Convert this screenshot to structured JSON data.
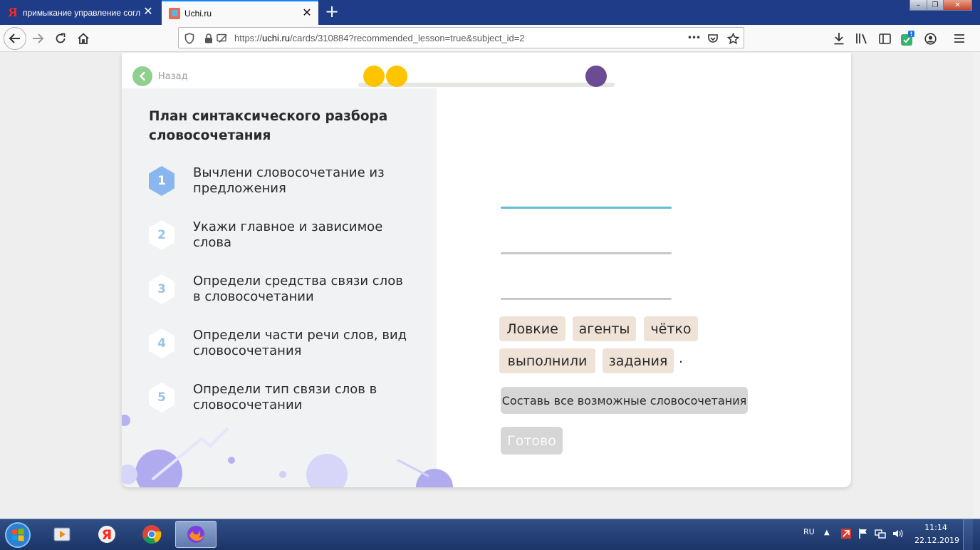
{
  "browser": {
    "tabs": [
      {
        "title": "примыкание управление соглас",
        "favicon": "yandex-icon",
        "active": false
      },
      {
        "title": "Uchi.ru",
        "favicon": "uchi-icon",
        "active": true
      }
    ],
    "url_prefix": "https://",
    "url_domain": "uchi.ru",
    "url_rest": "/cards/310884?recommended_lesson=true&subject_id=2",
    "url_more": "•••"
  },
  "lesson": {
    "back_label": "Назад",
    "progress_dots": [
      {
        "color": "#ffc400"
      },
      {
        "color": "#ffc400"
      },
      {
        "color": "#6b4b94"
      }
    ],
    "plan_title": "План синтаксического разбора словосочетания",
    "steps": [
      {
        "num": "1",
        "text": "Вычлени словосочетание из предложения",
        "active": true
      },
      {
        "num": "2",
        "text": "Укажи главное и зависимое слова",
        "active": false
      },
      {
        "num": "3",
        "text": "Определи средства связи слов в словосочетании",
        "active": false
      },
      {
        "num": "4",
        "text": "Определи части речи слов, вид словосочетания",
        "active": false
      },
      {
        "num": "5",
        "text": "Определи тип связи слов в словосочетании",
        "active": false
      }
    ],
    "words": [
      "Ловкие",
      "агенты",
      "чётко",
      "выполнили",
      "задания"
    ],
    "sentence_end": ".",
    "compose_button": "Составь все возможные словосочетания",
    "done_button": "Готово",
    "colors": {
      "active_step": "#8ab6f0",
      "word_chip": "#efe2d6",
      "active_line": "#5cc0d2",
      "decor": "#c9c6f5"
    }
  },
  "taskbar": {
    "items": [
      "start-orb",
      "media-player-icon",
      "yandex-browser-icon",
      "chrome-icon",
      "firefox-icon"
    ],
    "lang": "RU",
    "time": "11:14",
    "date": "22.12.2019"
  }
}
